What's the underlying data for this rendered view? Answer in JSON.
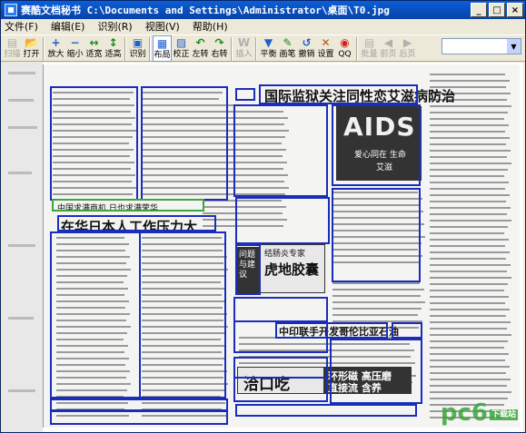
{
  "window": {
    "title": "赛酷文档秘书 C:\\Documents and Settings\\Administrator\\桌面\\T0.jpg",
    "controls": [
      "_",
      "□",
      "×"
    ]
  },
  "menu": [
    "文件(F)",
    "编辑(E)",
    "识别(R)",
    "视图(V)",
    "帮助(H)"
  ],
  "toolbar": {
    "buttons": [
      {
        "label": "扫描",
        "icon": "scanner-icon",
        "glyph": "▤",
        "disabled": true
      },
      {
        "label": "打开",
        "icon": "open-folder-icon",
        "glyph": "📂",
        "disabled": false
      },
      {
        "label": "放大",
        "icon": "zoom-in-icon",
        "glyph": "+",
        "disabled": false
      },
      {
        "label": "缩小",
        "icon": "zoom-out-icon",
        "glyph": "−",
        "disabled": false
      },
      {
        "label": "适宽",
        "icon": "fit-width-icon",
        "glyph": "↔",
        "disabled": false
      },
      {
        "label": "适高",
        "icon": "fit-height-icon",
        "glyph": "↕",
        "disabled": false
      },
      {
        "label": "识别",
        "icon": "recognize-icon",
        "glyph": "▣",
        "disabled": false
      },
      {
        "label": "布局",
        "icon": "layout-icon",
        "glyph": "▦",
        "disabled": false,
        "active": true
      },
      {
        "label": "校正",
        "icon": "correct-icon",
        "glyph": "▨",
        "disabled": false
      },
      {
        "label": "左转",
        "icon": "rotate-left-icon",
        "glyph": "↶",
        "disabled": false
      },
      {
        "label": "右转",
        "icon": "rotate-right-icon",
        "glyph": "↷",
        "disabled": false
      },
      {
        "label": "插入",
        "icon": "insert-icon",
        "glyph": "W",
        "disabled": true
      },
      {
        "label": "平衡",
        "icon": "balance-icon",
        "glyph": "▼",
        "disabled": false
      },
      {
        "label": "画笔",
        "icon": "pen-icon",
        "glyph": "✎",
        "disabled": false
      },
      {
        "label": "撤销",
        "icon": "undo-icon",
        "glyph": "↺",
        "disabled": false
      },
      {
        "label": "设置",
        "icon": "settings-icon",
        "glyph": "✕",
        "disabled": false
      },
      {
        "label": "QQ",
        "icon": "qq-icon",
        "glyph": "◉",
        "disabled": false
      },
      {
        "label": "批量",
        "icon": "batch-icon",
        "glyph": "▤",
        "disabled": true
      },
      {
        "label": "前页",
        "icon": "prev-page-icon",
        "glyph": "◀",
        "disabled": true
      },
      {
        "label": "后页",
        "icon": "next-page-icon",
        "glyph": "▶",
        "disabled": true
      }
    ]
  },
  "document": {
    "headlines": {
      "main": "国际监狱关注同性恋艾滋病防治",
      "left": "在华日本人工作压力大",
      "sub_left": "中国求满商机  日也求满荣华",
      "bottom_mid": "中印联手开发哥伦比亚石油",
      "ad1": "结肠炎专家",
      "ad2": "虎地胶囊",
      "ad3": "问题与建议",
      "ad4": "洽口吃",
      "ad5": "环形磁 高压磨",
      "ad6": "直接流 含养",
      "aids_title": "AIDS",
      "aids_sub1": "爱心同在 生命",
      "aids_sub2": "艾滋"
    }
  },
  "watermark": {
    "text": "pc6",
    "badge": "下载站"
  }
}
